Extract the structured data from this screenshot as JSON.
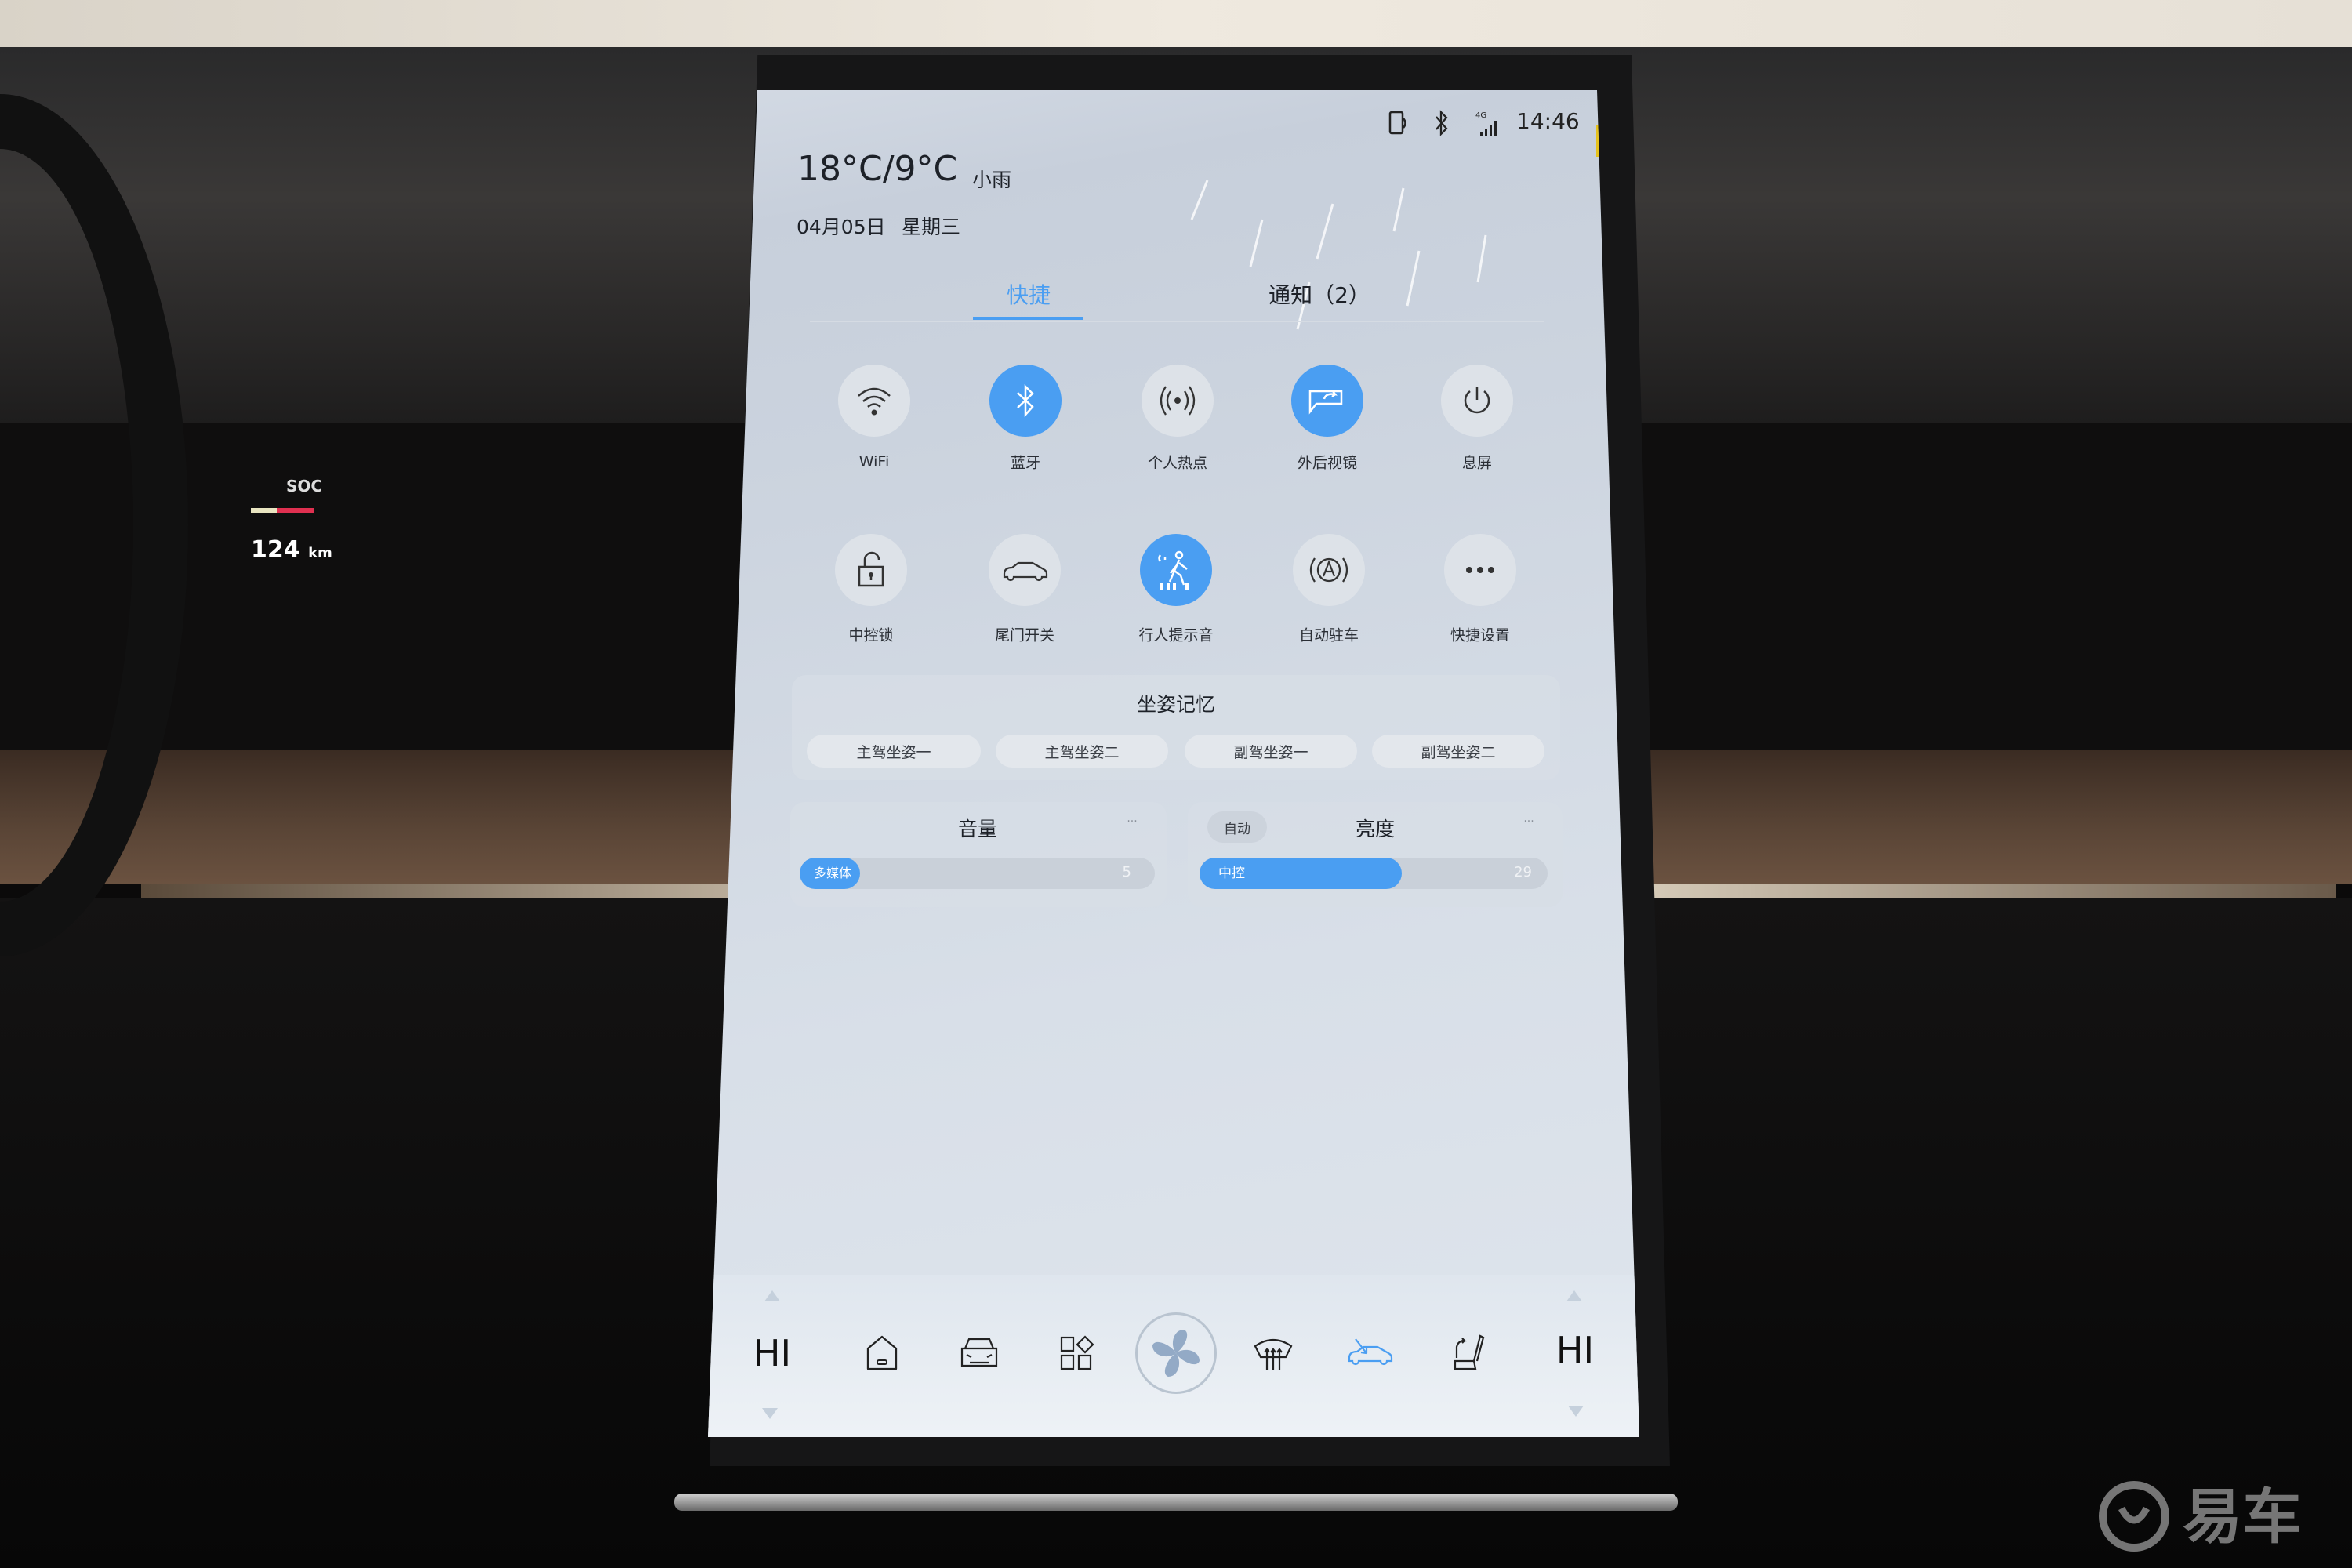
{
  "status_bar": {
    "time": "14:46",
    "icons": [
      "phone-projection-icon",
      "bluetooth-icon",
      "4g-signal-icon"
    ],
    "network_label": "4G"
  },
  "weather": {
    "temperature": "18°C/9°C",
    "condition": "小雨",
    "date": "04月05日",
    "weekday": "星期三"
  },
  "tabs": [
    {
      "label": "快捷",
      "active": true
    },
    {
      "label": "通知（2）",
      "active": false
    }
  ],
  "quick_toggles": [
    {
      "label": "WiFi",
      "icon": "wifi-icon",
      "active": false
    },
    {
      "label": "蓝牙",
      "icon": "bluetooth-icon",
      "active": true
    },
    {
      "label": "个人热点",
      "icon": "hotspot-icon",
      "active": false
    },
    {
      "label": "外后视镜",
      "icon": "mirror-fold-icon",
      "active": true
    },
    {
      "label": "息屏",
      "icon": "power-icon",
      "active": false
    },
    {
      "label": "中控锁",
      "icon": "unlock-icon",
      "active": false
    },
    {
      "label": "尾门开关",
      "icon": "car-tailgate-icon",
      "active": false
    },
    {
      "label": "行人提示音",
      "icon": "pedestrian-alert-icon",
      "active": true
    },
    {
      "label": "自动驻车",
      "icon": "auto-hold-icon",
      "active": false
    },
    {
      "label": "快捷设置",
      "icon": "more-icon",
      "active": false
    }
  ],
  "seat_memory": {
    "title": "坐姿记忆",
    "options": [
      "主驾坐姿一",
      "主驾坐姿二",
      "副驾坐姿一",
      "副驾坐姿二"
    ]
  },
  "volume": {
    "title": "音量",
    "channel": "多媒体",
    "value": "5",
    "max": 39,
    "more": "···"
  },
  "brightness": {
    "title": "亮度",
    "auto_label": "自动",
    "channel": "中控",
    "value": "29",
    "max": 50,
    "more": "···"
  },
  "climate_bar": {
    "left_temp": "HI",
    "right_temp": "HI",
    "icons": [
      "home-icon",
      "car-front-icon",
      "apps-icon",
      "fan-icon",
      "defrost-icon",
      "recirculation-icon",
      "seat-icon"
    ],
    "active_color": "#4a9ef2"
  },
  "cluster": {
    "soc_label": "SOC",
    "range": "124",
    "range_unit": "km"
  },
  "watermark": "易车",
  "colors": {
    "accent": "#4a9ef2",
    "text": "#1d2128"
  }
}
